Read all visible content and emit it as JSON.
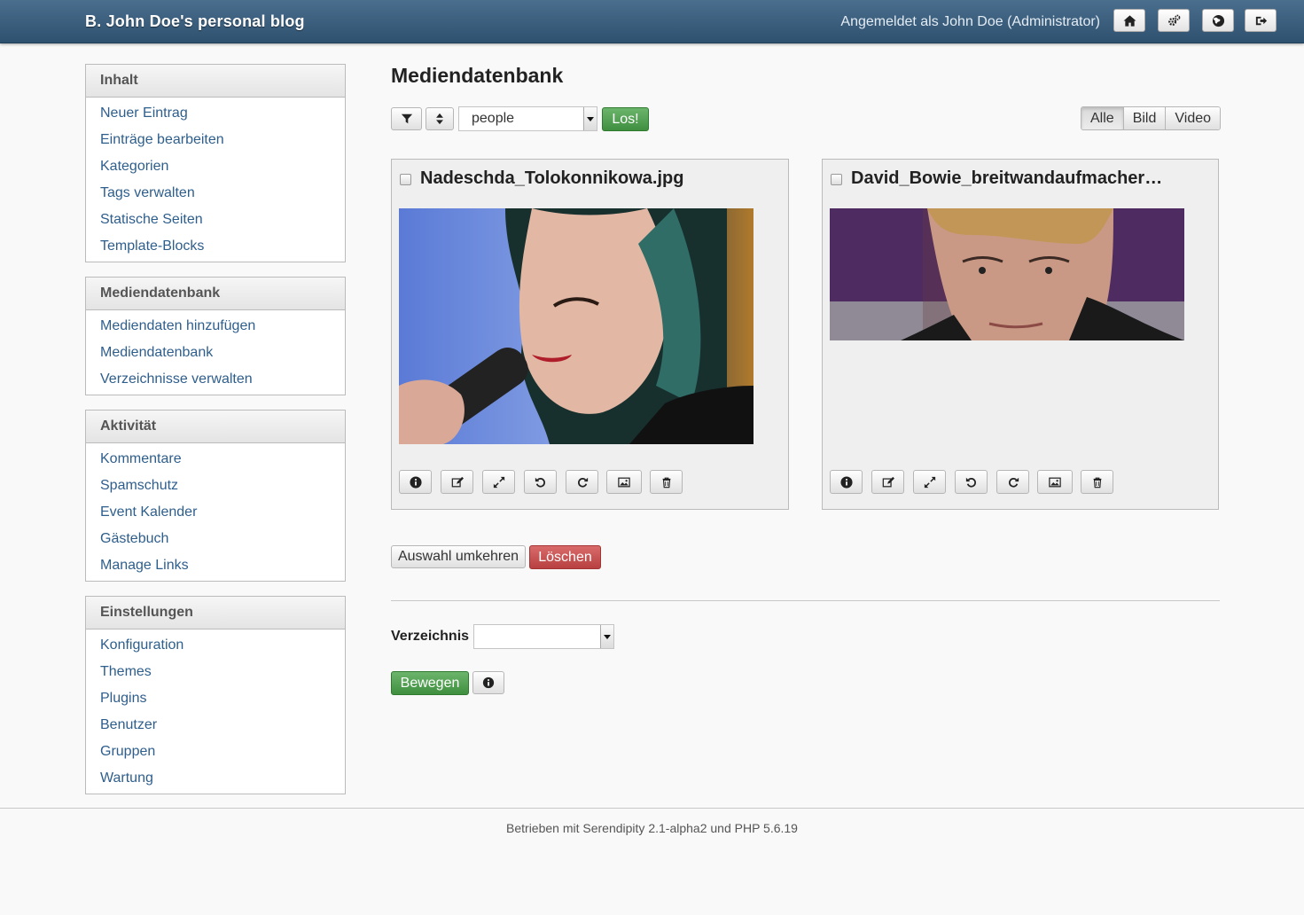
{
  "header": {
    "blog_title": "B. John Doe's personal blog",
    "login_info": "Angemeldet als John Doe (Administrator)",
    "buttons": [
      "home-icon",
      "cogs-icon",
      "globe-icon",
      "logout-icon"
    ]
  },
  "sidebar": {
    "sections": [
      {
        "title": "Inhalt",
        "items": [
          "Neuer Eintrag",
          "Einträge bearbeiten",
          "Kategorien",
          "Tags verwalten",
          "Statische Seiten",
          "Template-Blocks"
        ]
      },
      {
        "title": "Mediendatenbank",
        "items": [
          "Mediendaten hinzufügen",
          "Mediendatenbank",
          "Verzeichnisse verwalten"
        ]
      },
      {
        "title": "Aktivität",
        "items": [
          "Kommentare",
          "Spamschutz",
          "Event Kalender",
          "Gästebuch",
          "Manage Links"
        ]
      },
      {
        "title": "Einstellungen",
        "items": [
          "Konfiguration",
          "Themes",
          "Plugins",
          "Benutzer",
          "Gruppen",
          "Wartung"
        ]
      }
    ]
  },
  "main": {
    "title": "Mediendatenbank",
    "toolbar": {
      "filter_icon": "filter-icon",
      "sort_icon": "sort-icon",
      "directory_value": "people",
      "go_label": "Los!",
      "type_filters": [
        "Alle",
        "Bild",
        "Video"
      ],
      "active_filter": "Alle"
    },
    "media": [
      {
        "filename": "Nadeschda_Tolokonnikowa.jpg"
      },
      {
        "filename": "David_Bowie_breitwandaufmacher…"
      }
    ],
    "media_actions": [
      "info-icon",
      "edit-icon",
      "resize-icon",
      "rotate-left-icon",
      "rotate-right-icon",
      "image-icon",
      "delete-icon"
    ],
    "invert_selection_label": "Auswahl umkehren",
    "delete_label": "Löschen",
    "directory_label": "Verzeichnis",
    "directory_move_value": "",
    "move_label": "Bewegen"
  },
  "footer": {
    "text": "Betrieben mit Serendipity 2.1-alpha2 und PHP 5.6.19"
  }
}
